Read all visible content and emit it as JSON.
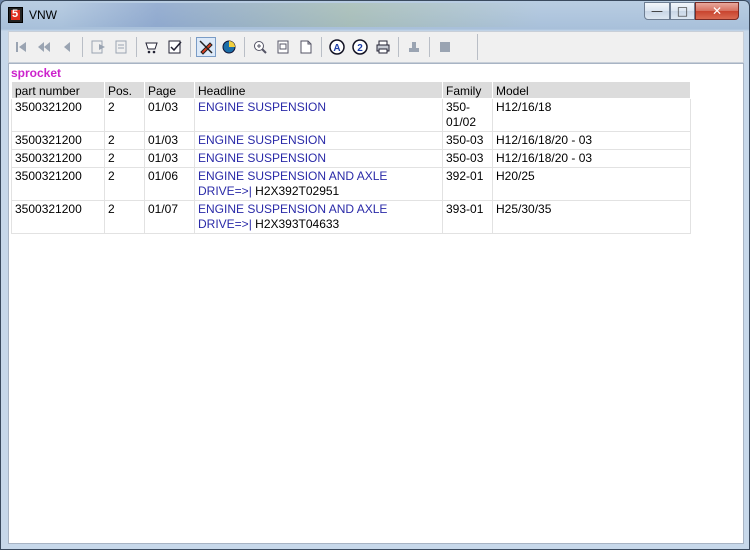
{
  "window": {
    "title": "VNW",
    "buttons": {
      "minimize": "—",
      "maximize": "□",
      "close": "✕"
    }
  },
  "toolbar": {
    "groups": [
      [
        "first-page-icon",
        "prev-fast-icon",
        "prev-icon"
      ],
      [
        "export-icon",
        "print-preview-icon"
      ],
      [
        "cart-icon",
        "checklist-icon"
      ],
      [
        "marker-icon",
        "pie-chart-icon"
      ],
      [
        "zoom-in-icon",
        "page-icon",
        "page-fold-icon"
      ],
      [
        "letter-a-icon",
        "number-2-icon",
        "printer-icon"
      ],
      [
        "stamp-icon"
      ],
      [
        "stop-icon"
      ]
    ]
  },
  "search": {
    "term": "sprocket"
  },
  "table": {
    "headers": {
      "part": "part number",
      "pos": "Pos.",
      "page": "Page",
      "headline": "Headline",
      "family": "Family",
      "model": "Model"
    },
    "rows": [
      {
        "part": "3500321200",
        "pos": "2",
        "page": "01/03",
        "headline": "ENGINE SUSPENSION",
        "ref": "",
        "family": "350-01/02",
        "model": "H12/16/18"
      },
      {
        "part": "3500321200",
        "pos": "2",
        "page": "01/03",
        "headline": "ENGINE SUSPENSION",
        "ref": "",
        "family": "350-03",
        "model": "H12/16/18/20 - 03"
      },
      {
        "part": "3500321200",
        "pos": "2",
        "page": "01/03",
        "headline": "ENGINE SUSPENSION",
        "ref": "",
        "family": "350-03",
        "model": "H12/16/18/20 - 03"
      },
      {
        "part": "3500321200",
        "pos": "2",
        "page": "01/06",
        "headline": "ENGINE SUSPENSION AND AXLE DRIVE=>|",
        "ref": " H2X392T02951",
        "family": "392-01",
        "model": "H20/25"
      },
      {
        "part": "3500321200",
        "pos": "2",
        "page": "01/07",
        "headline": "ENGINE SUSPENSION AND AXLE DRIVE=>|",
        "ref": " H2X393T04633",
        "family": "393-01",
        "model": "H25/30/35"
      }
    ]
  },
  "colors": {
    "search_term": "#cc22cc",
    "headline_link": "#2a2aa8",
    "header_bg": "#dcdcdc"
  }
}
